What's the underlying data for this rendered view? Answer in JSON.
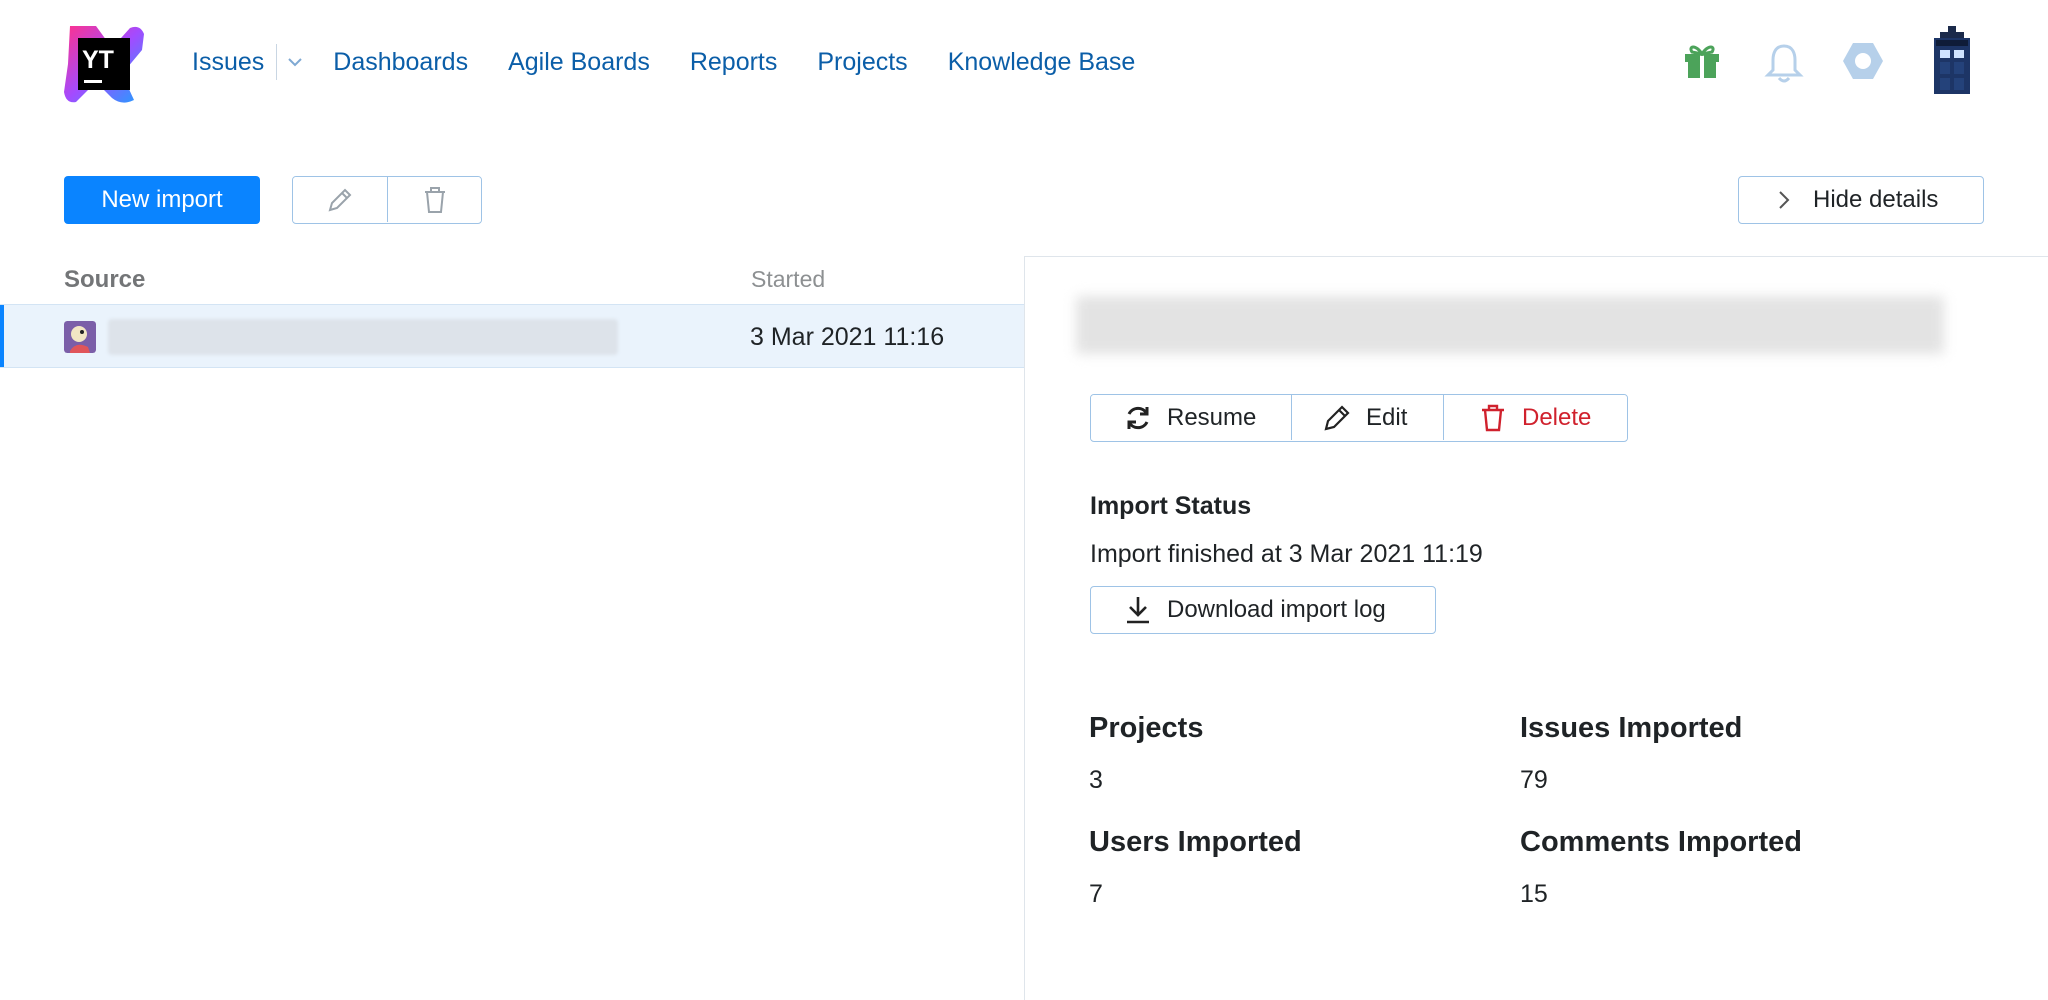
{
  "nav": {
    "items": [
      "Issues",
      "Dashboards",
      "Agile Boards",
      "Reports",
      "Projects",
      "Knowledge Base"
    ],
    "logo_text": "YT"
  },
  "toolbar": {
    "new_import_label": "New import",
    "hide_details_label": "Hide details"
  },
  "list": {
    "columns": {
      "source": "Source",
      "started": "Started"
    },
    "rows": [
      {
        "started": "3 Mar 2021 11:16"
      }
    ]
  },
  "details": {
    "actions": {
      "resume": "Resume",
      "edit": "Edit",
      "delete": "Delete"
    },
    "status_title": "Import Status",
    "status_text": "Import finished at 3 Mar 2021 11:19",
    "download_label": "Download import log",
    "stats": [
      {
        "label": "Projects",
        "value": "3"
      },
      {
        "label": "Issues Imported",
        "value": "79"
      },
      {
        "label": "Users Imported",
        "value": "7"
      },
      {
        "label": "Comments Imported",
        "value": "15"
      }
    ]
  },
  "colors": {
    "link": "#0b5ea8",
    "primary": "#0a84ff",
    "danger": "#d0212d",
    "gift": "#4ca35a",
    "muted_icon": "#b6d0ea"
  },
  "icons": [
    "youtrack-logo",
    "chevron-down-icon",
    "gift-icon",
    "bell-icon",
    "gear-icon",
    "avatar",
    "pencil-icon",
    "trash-icon",
    "chevron-right-icon",
    "refresh-icon",
    "download-icon"
  ]
}
